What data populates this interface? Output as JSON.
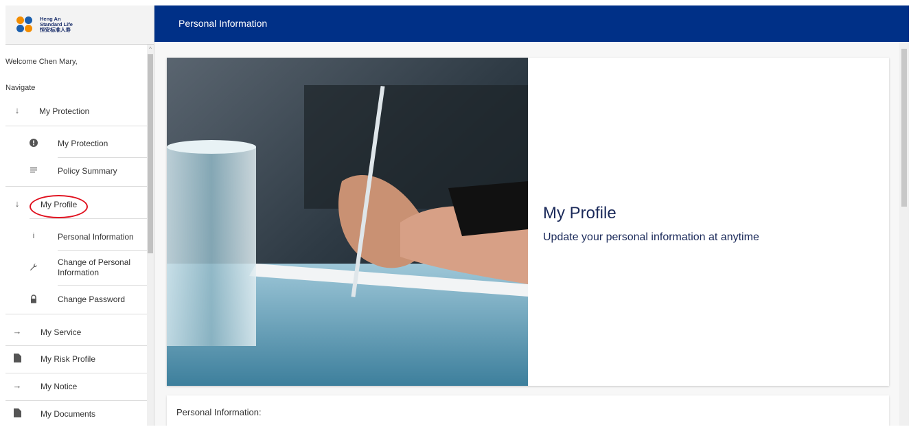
{
  "brand": {
    "line1": "Heng An",
    "line2": "Standard Life",
    "line3": "恒安标准人寿"
  },
  "sidebar": {
    "welcome": "Welcome Chen Mary,",
    "navigate": "Navigate",
    "items": [
      {
        "label": "My Protection",
        "icon": "arrow-down-icon"
      },
      {
        "label": "My Protection",
        "icon": "alert-icon"
      },
      {
        "label": "Policy Summary",
        "icon": "list-icon"
      },
      {
        "label": "My Profile",
        "icon": "arrow-down-icon"
      },
      {
        "label": "Personal Information",
        "icon": "info-icon"
      },
      {
        "label": "Change of Personal Information",
        "icon": "wrench-icon"
      },
      {
        "label": "Change Password",
        "icon": "lock-icon"
      },
      {
        "label": "My Service",
        "icon": "arrow-right-icon"
      },
      {
        "label": "My Risk Profile",
        "icon": "document-icon"
      },
      {
        "label": "My Notice",
        "icon": "arrow-right-icon"
      },
      {
        "label": "My Documents",
        "icon": "document-icon"
      }
    ]
  },
  "header": {
    "title": "Personal Information"
  },
  "main": {
    "card_title": "My Profile",
    "card_subtitle": "Update your personal information at anytime",
    "section_title": "Personal Information:"
  },
  "colors": {
    "header_bg": "#003087",
    "highlight_circle": "#e0101e",
    "text_dark": "#1b2a5a"
  }
}
